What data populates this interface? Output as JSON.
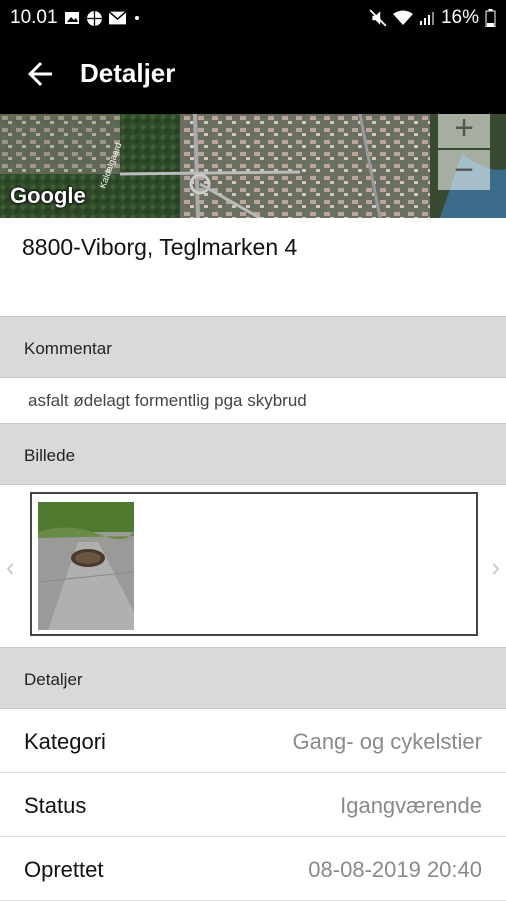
{
  "status_bar": {
    "time": "10.01",
    "battery": "16%",
    "icons_left": [
      "image-icon",
      "globe-icon",
      "mail-icon",
      "dot-icon"
    ],
    "icons_right": [
      "mute-icon",
      "wifi-icon",
      "signal-icon",
      "battery-icon"
    ]
  },
  "app_bar": {
    "title": "Detaljer",
    "back_icon": "arrow-back-icon"
  },
  "map": {
    "provider": "Google",
    "zoom_in": "+",
    "zoom_out": "−",
    "street_label": "Kaldalgaard"
  },
  "address": "8800-Viborg, Teglmarken 4",
  "sections": {
    "comment": {
      "header": "Kommentar",
      "text": "asfalt ødelagt formentlig pga skybrud"
    },
    "image": {
      "header": "Billede",
      "prev_icon": "chevron-left-icon",
      "next_icon": "chevron-right-icon"
    },
    "details": {
      "header": "Detaljer",
      "rows": [
        {
          "label": "Kategori",
          "value": "Gang- og cykelstier"
        },
        {
          "label": "Status",
          "value": "Igangværende"
        },
        {
          "label": "Oprettet",
          "value": "08-08-2019 20:40"
        }
      ]
    }
  }
}
